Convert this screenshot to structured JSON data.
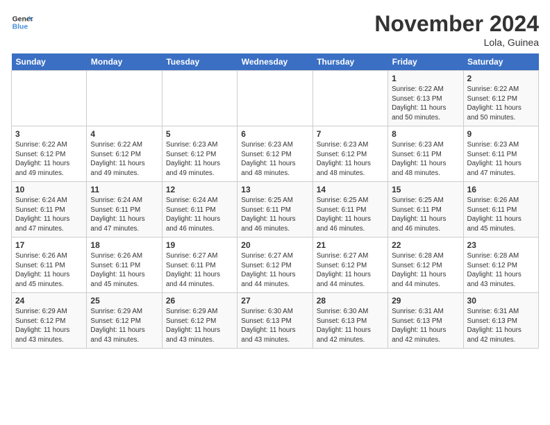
{
  "logo": {
    "text_general": "General",
    "text_blue": "Blue"
  },
  "title": "November 2024",
  "location": "Lola, Guinea",
  "header": {
    "days": [
      "Sunday",
      "Monday",
      "Tuesday",
      "Wednesday",
      "Thursday",
      "Friday",
      "Saturday"
    ]
  },
  "weeks": [
    [
      {
        "day": "",
        "info": ""
      },
      {
        "day": "",
        "info": ""
      },
      {
        "day": "",
        "info": ""
      },
      {
        "day": "",
        "info": ""
      },
      {
        "day": "",
        "info": ""
      },
      {
        "day": "1",
        "info": "Sunrise: 6:22 AM\nSunset: 6:13 PM\nDaylight: 11 hours\nand 50 minutes."
      },
      {
        "day": "2",
        "info": "Sunrise: 6:22 AM\nSunset: 6:12 PM\nDaylight: 11 hours\nand 50 minutes."
      }
    ],
    [
      {
        "day": "3",
        "info": "Sunrise: 6:22 AM\nSunset: 6:12 PM\nDaylight: 11 hours\nand 49 minutes."
      },
      {
        "day": "4",
        "info": "Sunrise: 6:22 AM\nSunset: 6:12 PM\nDaylight: 11 hours\nand 49 minutes."
      },
      {
        "day": "5",
        "info": "Sunrise: 6:23 AM\nSunset: 6:12 PM\nDaylight: 11 hours\nand 49 minutes."
      },
      {
        "day": "6",
        "info": "Sunrise: 6:23 AM\nSunset: 6:12 PM\nDaylight: 11 hours\nand 48 minutes."
      },
      {
        "day": "7",
        "info": "Sunrise: 6:23 AM\nSunset: 6:12 PM\nDaylight: 11 hours\nand 48 minutes."
      },
      {
        "day": "8",
        "info": "Sunrise: 6:23 AM\nSunset: 6:11 PM\nDaylight: 11 hours\nand 48 minutes."
      },
      {
        "day": "9",
        "info": "Sunrise: 6:23 AM\nSunset: 6:11 PM\nDaylight: 11 hours\nand 47 minutes."
      }
    ],
    [
      {
        "day": "10",
        "info": "Sunrise: 6:24 AM\nSunset: 6:11 PM\nDaylight: 11 hours\nand 47 minutes."
      },
      {
        "day": "11",
        "info": "Sunrise: 6:24 AM\nSunset: 6:11 PM\nDaylight: 11 hours\nand 47 minutes."
      },
      {
        "day": "12",
        "info": "Sunrise: 6:24 AM\nSunset: 6:11 PM\nDaylight: 11 hours\nand 46 minutes."
      },
      {
        "day": "13",
        "info": "Sunrise: 6:25 AM\nSunset: 6:11 PM\nDaylight: 11 hours\nand 46 minutes."
      },
      {
        "day": "14",
        "info": "Sunrise: 6:25 AM\nSunset: 6:11 PM\nDaylight: 11 hours\nand 46 minutes."
      },
      {
        "day": "15",
        "info": "Sunrise: 6:25 AM\nSunset: 6:11 PM\nDaylight: 11 hours\nand 46 minutes."
      },
      {
        "day": "16",
        "info": "Sunrise: 6:26 AM\nSunset: 6:11 PM\nDaylight: 11 hours\nand 45 minutes."
      }
    ],
    [
      {
        "day": "17",
        "info": "Sunrise: 6:26 AM\nSunset: 6:11 PM\nDaylight: 11 hours\nand 45 minutes."
      },
      {
        "day": "18",
        "info": "Sunrise: 6:26 AM\nSunset: 6:11 PM\nDaylight: 11 hours\nand 45 minutes."
      },
      {
        "day": "19",
        "info": "Sunrise: 6:27 AM\nSunset: 6:11 PM\nDaylight: 11 hours\nand 44 minutes."
      },
      {
        "day": "20",
        "info": "Sunrise: 6:27 AM\nSunset: 6:12 PM\nDaylight: 11 hours\nand 44 minutes."
      },
      {
        "day": "21",
        "info": "Sunrise: 6:27 AM\nSunset: 6:12 PM\nDaylight: 11 hours\nand 44 minutes."
      },
      {
        "day": "22",
        "info": "Sunrise: 6:28 AM\nSunset: 6:12 PM\nDaylight: 11 hours\nand 44 minutes."
      },
      {
        "day": "23",
        "info": "Sunrise: 6:28 AM\nSunset: 6:12 PM\nDaylight: 11 hours\nand 43 minutes."
      }
    ],
    [
      {
        "day": "24",
        "info": "Sunrise: 6:29 AM\nSunset: 6:12 PM\nDaylight: 11 hours\nand 43 minutes."
      },
      {
        "day": "25",
        "info": "Sunrise: 6:29 AM\nSunset: 6:12 PM\nDaylight: 11 hours\nand 43 minutes."
      },
      {
        "day": "26",
        "info": "Sunrise: 6:29 AM\nSunset: 6:12 PM\nDaylight: 11 hours\nand 43 minutes."
      },
      {
        "day": "27",
        "info": "Sunrise: 6:30 AM\nSunset: 6:13 PM\nDaylight: 11 hours\nand 43 minutes."
      },
      {
        "day": "28",
        "info": "Sunrise: 6:30 AM\nSunset: 6:13 PM\nDaylight: 11 hours\nand 42 minutes."
      },
      {
        "day": "29",
        "info": "Sunrise: 6:31 AM\nSunset: 6:13 PM\nDaylight: 11 hours\nand 42 minutes."
      },
      {
        "day": "30",
        "info": "Sunrise: 6:31 AM\nSunset: 6:13 PM\nDaylight: 11 hours\nand 42 minutes."
      }
    ]
  ]
}
